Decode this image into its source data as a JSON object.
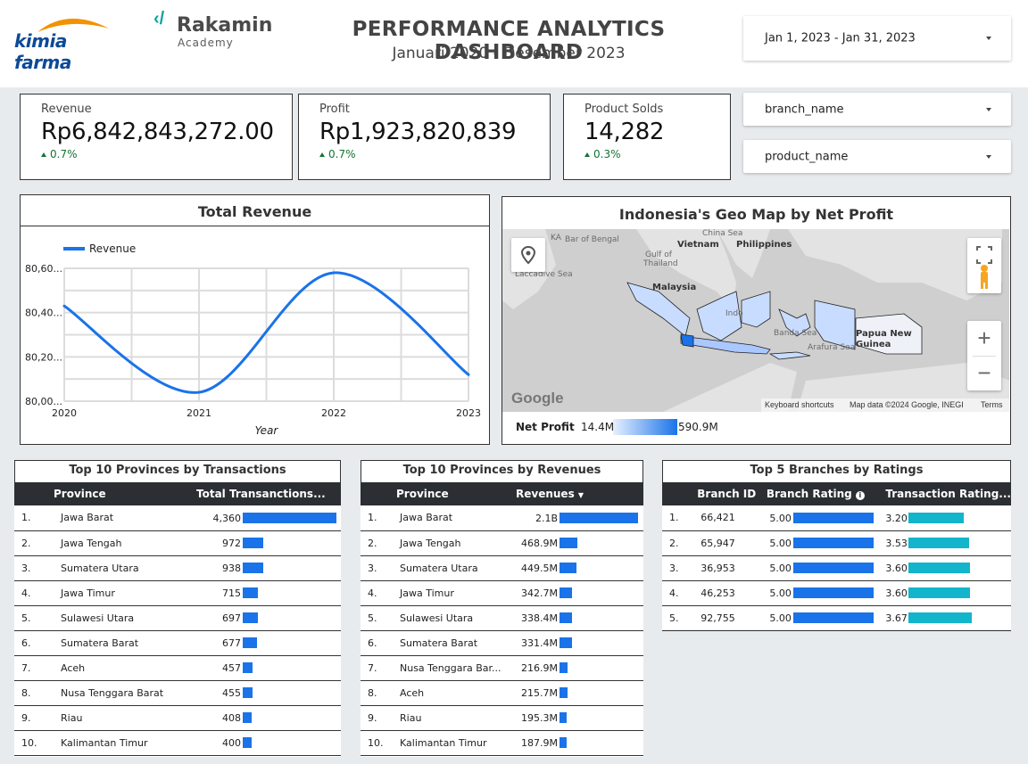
{
  "header": {
    "logo_left": "kimia farma",
    "logo_right_title": "Rakamin",
    "logo_right_sub": "Academy",
    "title": "PERFORMANCE ANALYTICS DASHBOARD",
    "subtitle": "Januari 2020 - Desember 2023",
    "date_range": "Jan 1, 2023 - Jan 31, 2023"
  },
  "filters": {
    "branch": "branch_name",
    "product": "product_name"
  },
  "kpis": {
    "revenue": {
      "label": "Revenue",
      "value": "Rp6,842,843,272.00",
      "delta": "0.7%"
    },
    "profit": {
      "label": "Profit",
      "value": "Rp1,923,820,839",
      "delta": "0.7%"
    },
    "sold": {
      "label": "Product Solds",
      "value": "14,282",
      "delta": "0.3%"
    }
  },
  "colors": {
    "accent": "#1a73e8",
    "teal": "#12b5cb",
    "positive": "#137333",
    "table_header": "#2b2f33"
  },
  "chart_data": {
    "type": "line",
    "title": "Total Revenue",
    "xlabel": "Year",
    "ylabel": "",
    "x": [
      "2020",
      "2021",
      "2022",
      "2023"
    ],
    "yticks": [
      "80,00...",
      "80,20...",
      "80,40...",
      "80,60..."
    ],
    "ylim": [
      80000,
      80600
    ],
    "series": [
      {
        "name": "Revenue",
        "values": [
          80430,
          80040,
          80580,
          80120
        ]
      }
    ],
    "legend": "top-left",
    "grid": true
  },
  "map": {
    "title": "Indonesia's Geo Map by Net Profit",
    "labels": {
      "bay": "Bar of Bengal",
      "china_sea": "China Sea",
      "vietnam": "Vietnam",
      "philippines": "Philippines",
      "gulf": "Gulf of",
      "thailand": "Thailand",
      "laccadive": "Laccadive Sea",
      "malaysia": "Malaysia",
      "indo": "Indo",
      "banda": "Banda Sea",
      "arafura": "Arafura Sea",
      "png": "Papua New Guinea",
      "ka": "KA"
    },
    "google": "Google",
    "shortcuts": "Keyboard shortcuts",
    "attribution": "Map data ©2024 Google, INEGI",
    "terms": "Terms",
    "legend_label": "Net Profit",
    "legend_min": "14.4M",
    "legend_max": "590.9M",
    "zoom_in": "+",
    "zoom_out": "−"
  },
  "transactions": {
    "title": "Top 10 Provinces by Transactions",
    "col_province": "Province",
    "col_value": "Total Transanctions...",
    "max": 4360,
    "rows": [
      {
        "rank": "1.",
        "province": "Jawa Barat",
        "value": "4,360",
        "num": 4360
      },
      {
        "rank": "2.",
        "province": "Jawa Tengah",
        "value": "972",
        "num": 972
      },
      {
        "rank": "3.",
        "province": "Sumatera Utara",
        "value": "938",
        "num": 938
      },
      {
        "rank": "4.",
        "province": "Jawa Timur",
        "value": "715",
        "num": 715
      },
      {
        "rank": "5.",
        "province": "Sulawesi Utara",
        "value": "697",
        "num": 697
      },
      {
        "rank": "6.",
        "province": "Sumatera Barat",
        "value": "677",
        "num": 677
      },
      {
        "rank": "7.",
        "province": "Aceh",
        "value": "457",
        "num": 457
      },
      {
        "rank": "8.",
        "province": "Nusa Tenggara Barat",
        "value": "455",
        "num": 455
      },
      {
        "rank": "9.",
        "province": "Riau",
        "value": "408",
        "num": 408
      },
      {
        "rank": "10.",
        "province": "Kalimantan Timur",
        "value": "400",
        "num": 400
      }
    ]
  },
  "revenues": {
    "title": "Top 10 Provinces by Revenues",
    "col_province": "Province",
    "col_value": "Revenues",
    "sort_icon": "sort-desc-icon",
    "max": 2100,
    "rows": [
      {
        "rank": "1.",
        "province": "Jawa Barat",
        "value": "2.1B",
        "num": 2100
      },
      {
        "rank": "2.",
        "province": "Jawa Tengah",
        "value": "468.9M",
        "num": 468.9
      },
      {
        "rank": "3.",
        "province": "Sumatera Utara",
        "value": "449.5M",
        "num": 449.5
      },
      {
        "rank": "4.",
        "province": "Jawa Timur",
        "value": "342.7M",
        "num": 342.7
      },
      {
        "rank": "5.",
        "province": "Sulawesi Utara",
        "value": "338.4M",
        "num": 338.4
      },
      {
        "rank": "6.",
        "province": "Sumatera Barat",
        "value": "331.4M",
        "num": 331.4
      },
      {
        "rank": "7.",
        "province": "Nusa Tenggara Bar...",
        "value": "216.9M",
        "num": 216.9
      },
      {
        "rank": "8.",
        "province": "Aceh",
        "value": "215.7M",
        "num": 215.7
      },
      {
        "rank": "9.",
        "province": "Riau",
        "value": "195.3M",
        "num": 195.3
      },
      {
        "rank": "10.",
        "province": "Kalimantan Timur",
        "value": "187.9M",
        "num": 187.9
      }
    ]
  },
  "branches": {
    "title": "Top 5 Branches by Ratings",
    "col_id": "Branch ID",
    "col_rating": "Branch Rating",
    "col_trx": "Transaction Rating...",
    "info_icon": "info-icon",
    "rating_max": 5,
    "rows": [
      {
        "rank": "1.",
        "id": "66,421",
        "rating": "5.00",
        "rating_num": 5.0,
        "trx": "3.20",
        "trx_num": 3.2
      },
      {
        "rank": "2.",
        "id": "65,947",
        "rating": "5.00",
        "rating_num": 5.0,
        "trx": "3.53",
        "trx_num": 3.53
      },
      {
        "rank": "3.",
        "id": "36,953",
        "rating": "5.00",
        "rating_num": 5.0,
        "trx": "3.60",
        "trx_num": 3.6
      },
      {
        "rank": "4.",
        "id": "46,253",
        "rating": "5.00",
        "rating_num": 5.0,
        "trx": "3.60",
        "trx_num": 3.6
      },
      {
        "rank": "5.",
        "id": "92,755",
        "rating": "5.00",
        "rating_num": 5.0,
        "trx": "3.67",
        "trx_num": 3.67
      }
    ]
  }
}
